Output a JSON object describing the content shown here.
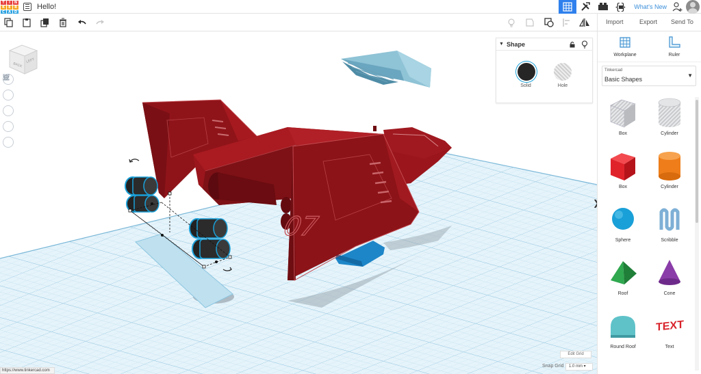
{
  "app": {
    "logo_letters": [
      "T",
      "I",
      "N",
      "K",
      "E",
      "R",
      "C",
      "A",
      "D"
    ],
    "logo_colors": [
      "#e8423f",
      "#e8423f",
      "#e8423f",
      "#f5a623",
      "#f5a623",
      "#f5a623",
      "#2ea3e0",
      "#2ea3e0",
      "#2ea3e0"
    ],
    "document_title": "Hello!",
    "whats_new_label": "What's New",
    "accent": "#2f80ed"
  },
  "toolbar": {
    "import_label": "Import",
    "export_label": "Export",
    "send_to_label": "Send To"
  },
  "viewcube": {
    "face_back": "BACK",
    "face_left": "LEFT"
  },
  "inspector": {
    "title": "Shape",
    "solid_label": "Solid",
    "hole_label": "Hole",
    "solid_color": "#262626"
  },
  "panel": {
    "workplane_label": "Workplane",
    "ruler_label": "Ruler",
    "library_small": "Tinkercad",
    "library_name": "Basic Shapes",
    "shapes": [
      {
        "name": "Box",
        "icon": "striped-box-icon"
      },
      {
        "name": "Cylinder",
        "icon": "striped-cylinder-icon"
      },
      {
        "name": "Box",
        "icon": "red-box-icon",
        "color": "#e0232b"
      },
      {
        "name": "Cylinder",
        "icon": "orange-cylinder-icon",
        "color": "#ee7d1a"
      },
      {
        "name": "Sphere",
        "icon": "blue-sphere-icon",
        "color": "#1aa0d8"
      },
      {
        "name": "Scribble",
        "icon": "scribble-icon",
        "color": "#7fb0d6"
      },
      {
        "name": "Roof",
        "icon": "green-roof-icon",
        "color": "#2fa84f"
      },
      {
        "name": "Cone",
        "icon": "purple-cone-icon",
        "color": "#8a3ca8"
      },
      {
        "name": "Round Roof",
        "icon": "teal-round-roof-icon",
        "color": "#5fc2c9"
      },
      {
        "name": "Text",
        "icon": "red-text-icon",
        "color": "#d8232b"
      }
    ]
  },
  "grid_controls": {
    "edit_grid_label": "Edit Grid",
    "snap_grid_label": "Snap Grid",
    "snap_value": "1.0 mm"
  },
  "status": {
    "url": "https://www.tinkercad.com"
  },
  "model": {
    "hull_color": "#8f1419",
    "hull_light": "#a5191f",
    "hull_dark": "#6e0d12",
    "selection_color": "#1aa0d8",
    "hull_marking": "07"
  }
}
